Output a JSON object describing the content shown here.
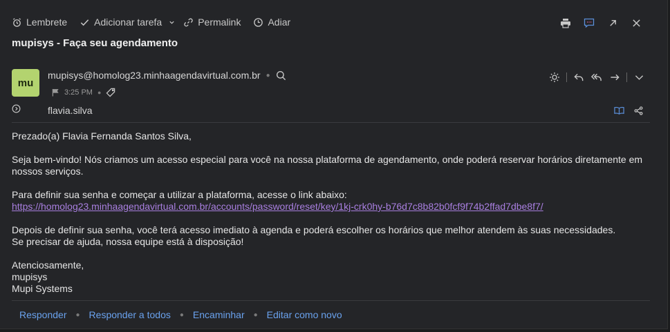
{
  "toolbar": {
    "reminder": "Lembrete",
    "add_task": "Adicionar tarefa",
    "permalink": "Permalink",
    "snooze": "Adiar"
  },
  "subject": "mupisys - Faça seu agendamento",
  "sender": {
    "initials": "mu",
    "email": "mupisys@homolog23.minhaagendavirtual.com.br",
    "time": "3:25 PM",
    "avatar_color": "#b3d36f"
  },
  "recipient": "flavia.silva",
  "body": {
    "greeting": "Prezado(a) Flavia Fernanda Santos Silva,",
    "paragraph1": "Seja bem-vindo! Nós criamos um acesso especial para você na nossa plataforma de agendamento, onde poderá reservar horários diretamente em nossos serviços.",
    "paragraph2": "Para definir sua senha e começar a utilizar a plataforma, acesse o link abaixo:",
    "link": "https://homolog23.minhaagendavirtual.com.br/accounts/password/reset/key/1kj-crk0hy-b76d7c8b82b0fcf9f74b2ffad7dbe8f7/",
    "paragraph3_line1": "Depois de definir sua senha, você terá acesso imediato à agenda e poderá escolher os horários que melhor atendem às suas necessidades.",
    "paragraph3_line2": "Se precisar de ajuda, nossa equipe está à disposição!",
    "closing": "Atenciosamente,",
    "signature_line1": "mupisys",
    "signature_line2": "Mupi Systems"
  },
  "footer": {
    "reply": "Responder",
    "reply_all": "Responder a todos",
    "forward": "Encaminhar",
    "edit_as_new": "Editar como novo"
  },
  "colors": {
    "background": "#242528",
    "link_purple": "#a97fe0",
    "action_blue": "#6aa2ee"
  }
}
